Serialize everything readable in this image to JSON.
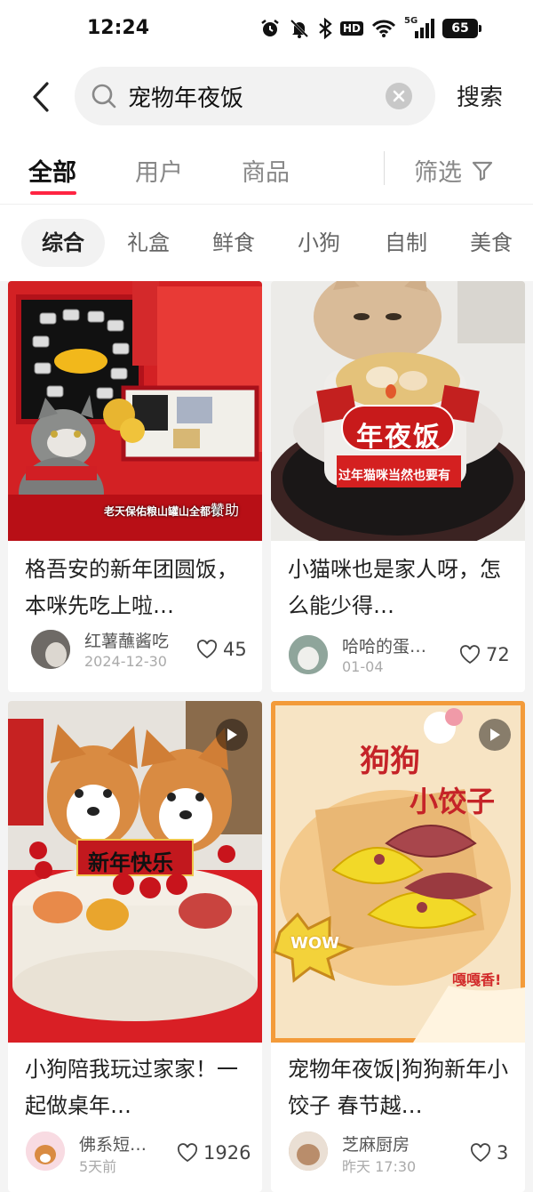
{
  "status_bar": {
    "time": "12:24",
    "hd_label": "HD",
    "signal_label": "5G",
    "battery": "65"
  },
  "search": {
    "query": "宠物年夜饭",
    "submit_label": "搜索"
  },
  "main_tabs": [
    {
      "label": "全部",
      "active": true
    },
    {
      "label": "用户",
      "active": false
    },
    {
      "label": "商品",
      "active": false
    }
  ],
  "filter_label": "筛选",
  "chips": [
    "综合",
    "礼盒",
    "鲜食",
    "小狗",
    "自制",
    "美食"
  ],
  "active_chip": "综合",
  "colors": {
    "accent": "#ff2442",
    "red_theme": "#d71a1f"
  },
  "posts": [
    {
      "title": "格吾安的新年团圆饭，本咪先吃上啦…",
      "author": "红薯蘸酱吃",
      "date": "2024-12-30",
      "likes": "45",
      "image_caption": "老天保佑粮山罐山全都有",
      "image_sticker": "赞助",
      "has_video": false
    },
    {
      "title": "小猫咪也是家人呀，怎么能少得…",
      "author": "哈哈的蛋…",
      "date": "01-04",
      "likes": "72",
      "image_banner": "年夜饭",
      "image_caption": "过年猫咪当然也要有",
      "has_video": false
    },
    {
      "title": "小狗陪我玩过家家！一起做桌年…",
      "author": "佛系短…",
      "date": "5天前",
      "likes": "1926",
      "image_sign": "新年快乐",
      "has_video": true
    },
    {
      "title": "宠物年夜饭|狗狗新年小饺子 春节越…",
      "author": "芝麻厨房",
      "date": "昨天 17:30",
      "likes": "3",
      "image_headline_1": "狗狗",
      "image_headline_2": "小饺子",
      "image_badge": "WOW",
      "image_tag": "嘎嘎香!",
      "has_video": true
    }
  ]
}
